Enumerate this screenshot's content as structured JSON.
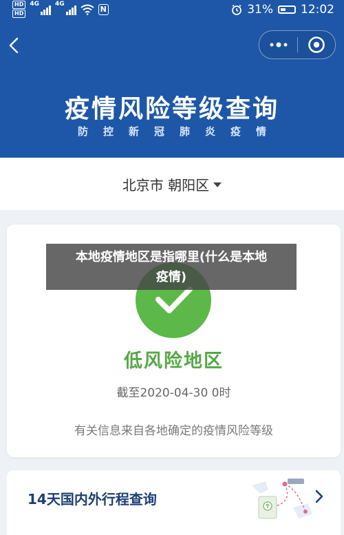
{
  "status_bar": {
    "hd_badge_1": "HD",
    "hd_badge_2": "HD",
    "network_1": "4G",
    "network_2": "4G",
    "nfc_letter": "N",
    "battery_percent": "31%",
    "time": "12:02"
  },
  "header": {
    "capsule_more": "•••",
    "title": "疫情风险等级查询",
    "subtitle": "防控新冠肺炎疫情"
  },
  "location": {
    "label": "北京市 朝阳区"
  },
  "risk_card": {
    "level": "低风险地区",
    "as_of": "截至2020-04-30 0时",
    "source_note": "有关信息来自各地确定的疫情风险等级",
    "level_color": "#5cb848"
  },
  "overlay": {
    "caption_line1": "本地疫情地区是指哪里(什么是本地",
    "caption_line2": "疫情)"
  },
  "trip_card": {
    "label": "14天国内外行程查询"
  },
  "colors": {
    "header_blue": "#1e57a8",
    "risk_green": "#5cb848",
    "trip_label": "#1e3f73"
  }
}
